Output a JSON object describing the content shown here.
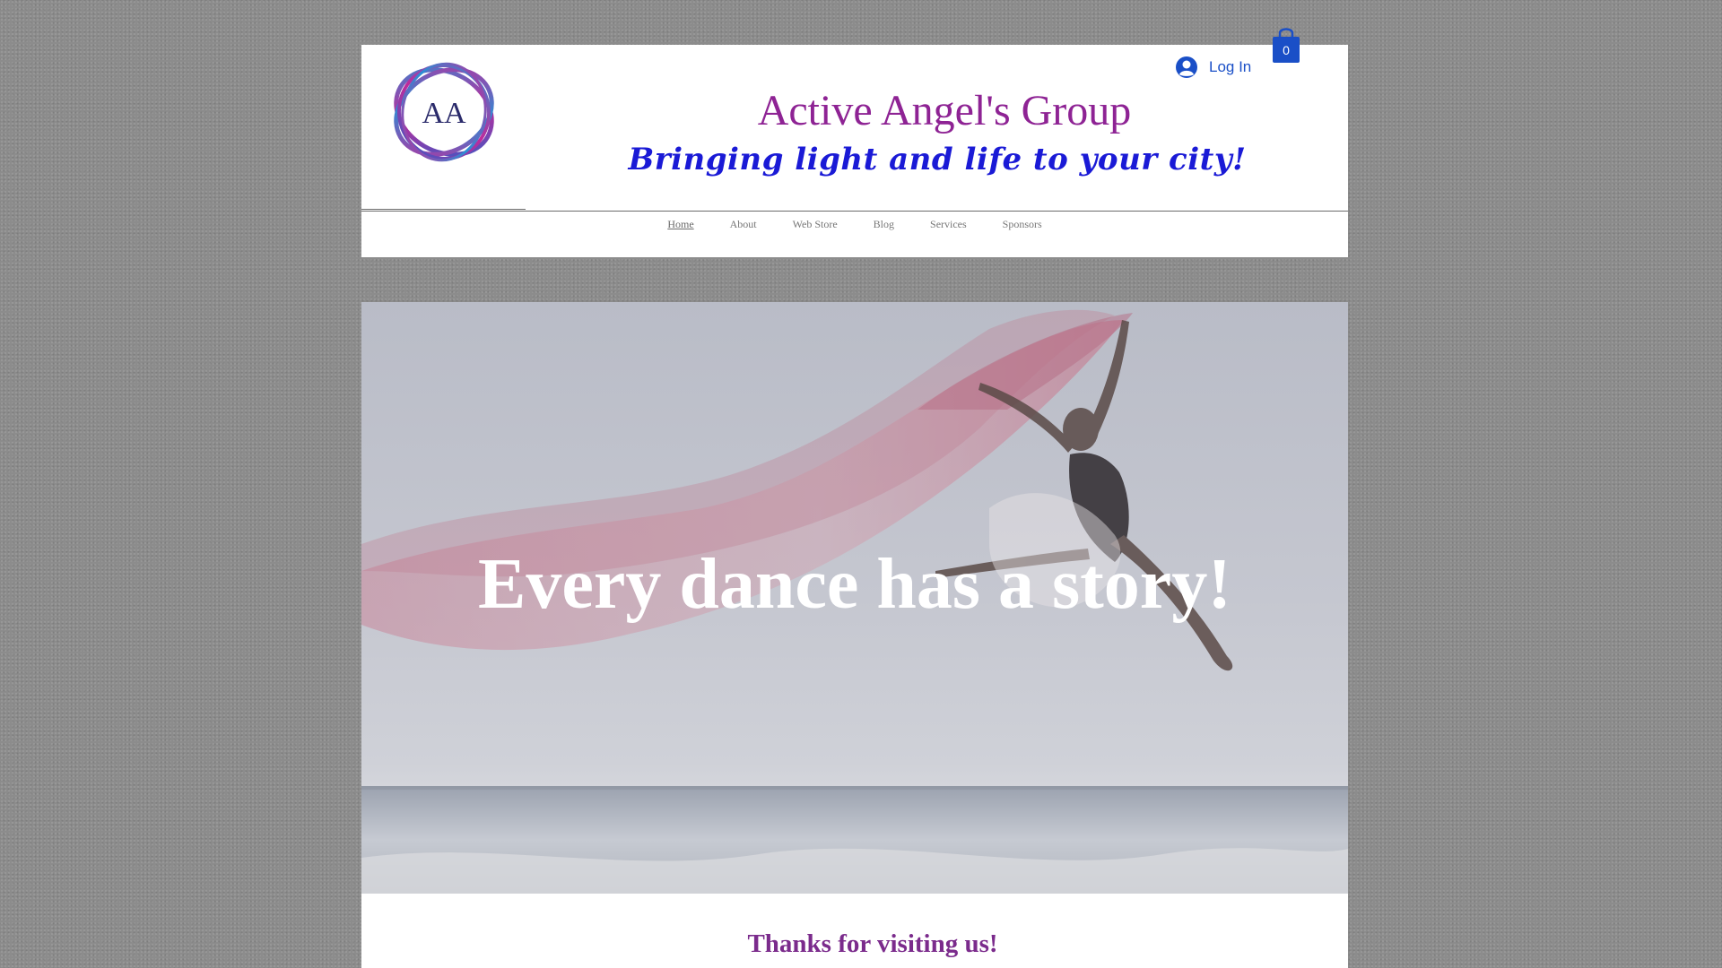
{
  "header": {
    "logo_text": "AA",
    "site_title": "Active Angel's Group",
    "tagline": "Bringing light and life to your city!",
    "login_label": "Log In",
    "cart_count": "0"
  },
  "nav": {
    "items": [
      {
        "label": "Home",
        "active": true
      },
      {
        "label": "About"
      },
      {
        "label": "Web Store"
      },
      {
        "label": "Blog"
      },
      {
        "label": "Services"
      },
      {
        "label": "Sponsors"
      }
    ]
  },
  "hero": {
    "headline": "Every dance has a story!"
  },
  "content": {
    "thanks": "Thanks for visiting us!"
  },
  "colors": {
    "title": "#8e2394",
    "tagline": "#1a1ad6",
    "login": "#1a4fc7",
    "thanks": "#7b2b8c"
  }
}
